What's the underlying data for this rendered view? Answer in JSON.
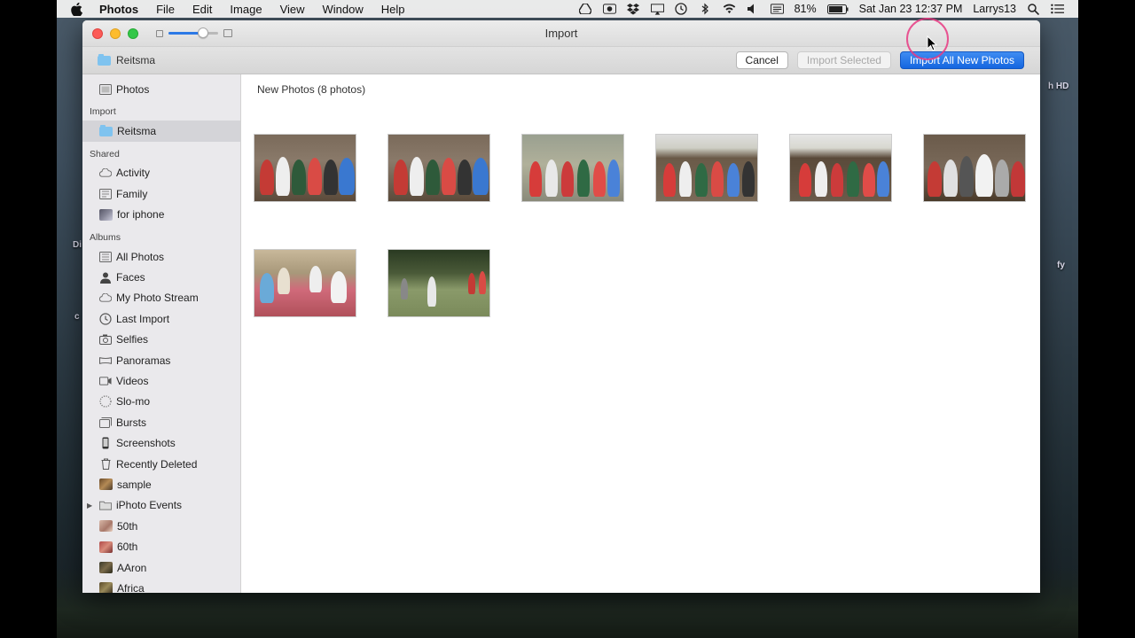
{
  "menubar": {
    "app_name": "Photos",
    "menus": [
      "File",
      "Edit",
      "Image",
      "View",
      "Window",
      "Help"
    ],
    "battery": "81%",
    "datetime": "Sat Jan 23  12:37 PM",
    "user": "Larrys13"
  },
  "desktop": {
    "labels": [
      "h HD",
      "fy",
      "Di",
      "c"
    ]
  },
  "window": {
    "title": "Import",
    "source_name": "Reitsma",
    "buttons": {
      "cancel": "Cancel",
      "import_selected": "Import Selected",
      "import_all": "Import All New Photos"
    }
  },
  "sidebar": {
    "photos": "Photos",
    "import_header": "Import",
    "import_item": "Reitsma",
    "shared_header": "Shared",
    "shared": [
      "Activity",
      "Family",
      "for iphone"
    ],
    "albums_header": "Albums",
    "albums": [
      "All Photos",
      "Faces",
      "My Photo Stream",
      "Last Import",
      "Selfies",
      "Panoramas",
      "Videos",
      "Slo-mo",
      "Bursts",
      "Screenshots",
      "Recently Deleted",
      "sample",
      "iPhoto Events",
      "50th",
      "60th",
      "AAron",
      "Africa"
    ]
  },
  "main": {
    "title": "New Photos (8 photos)",
    "photo_count": 8
  }
}
